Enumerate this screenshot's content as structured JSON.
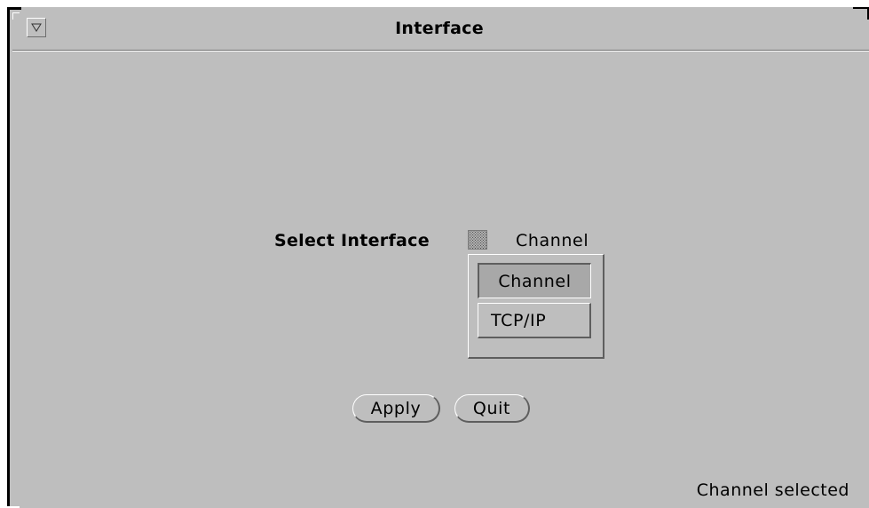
{
  "window": {
    "title": "Interface",
    "menu_icon": "triangle-down-icon"
  },
  "form": {
    "select_label": "Select Interface",
    "current_value": "Channel",
    "menu_icon": "abbreviated-menu-icon",
    "options": [
      {
        "label": "Channel",
        "selected": true
      },
      {
        "label": "TCP/IP",
        "selected": false
      }
    ]
  },
  "buttons": {
    "apply_label": "Apply",
    "quit_label": "Quit"
  },
  "footer": {
    "status": "Channel selected"
  },
  "colors": {
    "background": "#bebebe",
    "shadow": "#5e5e5e",
    "highlight": "#ffffff"
  }
}
